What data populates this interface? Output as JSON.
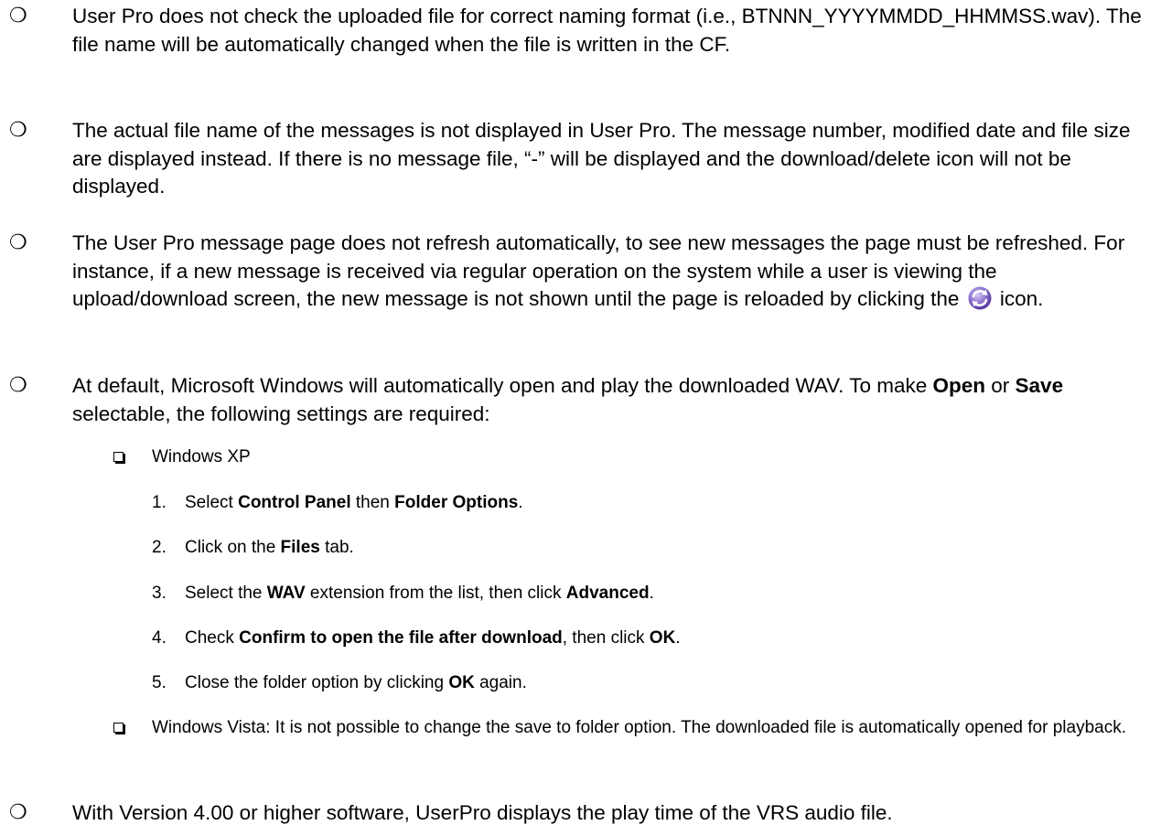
{
  "bullets": [
    {
      "mark": "❍",
      "text": "User Pro does not check the uploaded file for correct naming format (i.e., BTNNN_YYYYMMDD_HHMMSS.wav). The file name will be automatically changed when the file is written in the CF."
    },
    {
      "mark": "❍",
      "text": "The actual file name of the messages is not displayed in User Pro. The message number, modified date and file size are displayed instead. If there is no message file, “-” will be displayed and the download/delete icon will not be displayed."
    },
    {
      "mark": "❍",
      "text_before_icon": "The User Pro message page does not refresh automatically, to see new messages the page must be refreshed. For instance, if a new message is received via regular operation on the system while a user is viewing the upload/download screen, the new message is not shown until the page is reloaded by clicking the",
      "text_after_icon": "icon.",
      "icon": "refresh-icon"
    },
    {
      "mark": "❍",
      "parts": [
        "At default, Microsoft Windows will automatically open and play the downloaded WAV. To make ",
        "Open",
        " or ",
        "Save",
        " selectable, the following settings are required:"
      ]
    },
    {
      "mark": "❍",
      "text": "With Version 4.00 or higher software, UserPro displays the play time of the VRS audio file."
    }
  ],
  "sub_items": [
    {
      "text": "Windows XP"
    },
    {
      "text": "Windows Vista: It is not possible to change the save to folder option. The downloaded file is automatically opened for playback."
    }
  ],
  "steps": [
    {
      "num": "1.",
      "parts": [
        "Select ",
        "Control Panel",
        " then ",
        "Folder Options",
        "."
      ]
    },
    {
      "num": "2.",
      "parts": [
        "Click on the ",
        "Files",
        " tab."
      ]
    },
    {
      "num": "3.",
      "parts": [
        "Select the ",
        "WAV",
        " extension from the list, then click ",
        "Advanced",
        "."
      ]
    },
    {
      "num": "4.",
      "parts": [
        "Check ",
        "Confirm to open the file after download",
        ", then click ",
        "OK",
        "."
      ]
    },
    {
      "num": "5.",
      "parts": [
        "Close the folder option by clicking ",
        "OK",
        " again."
      ]
    }
  ]
}
